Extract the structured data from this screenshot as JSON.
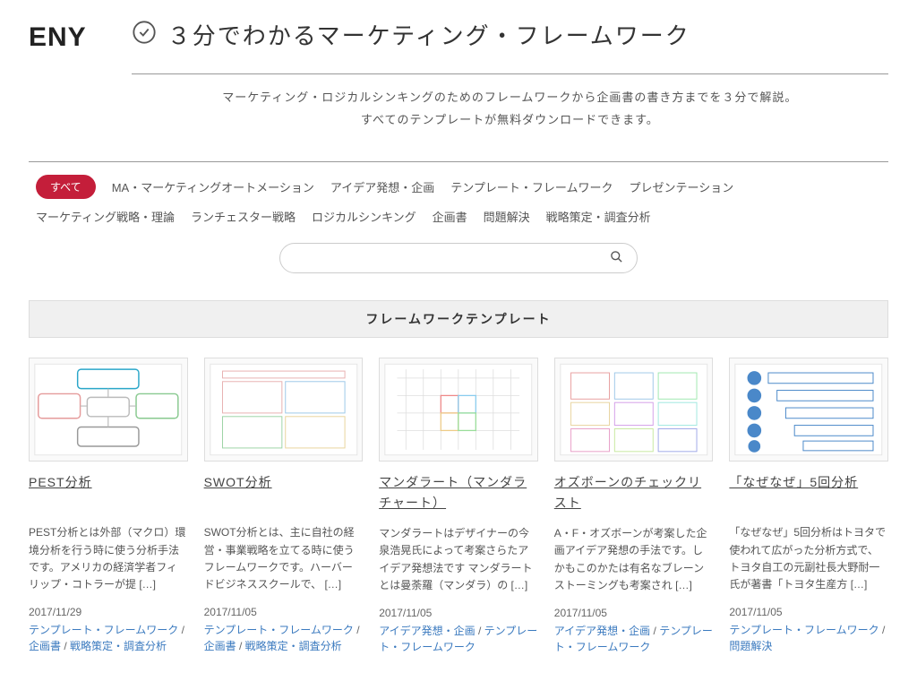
{
  "logo": "ENY",
  "site_title": "３分でわかるマーケティング・フレームワーク",
  "subtitle_line1": "マーケティング・ロジカルシンキングのためのフレームワークから企画書の書き方までを３分で解説。",
  "subtitle_line2": "すべてのテンプレートが無料ダウンロードできます。",
  "categories": [
    {
      "label": "すべて",
      "active": true
    },
    {
      "label": "MA・マーケティングオートメーション",
      "active": false
    },
    {
      "label": "アイデア発想・企画",
      "active": false
    },
    {
      "label": "テンプレート・フレームワーク",
      "active": false
    },
    {
      "label": "プレゼンテーション",
      "active": false
    },
    {
      "label": "マーケティング戦略・理論",
      "active": false
    },
    {
      "label": "ランチェスター戦略",
      "active": false
    },
    {
      "label": "ロジカルシンキング",
      "active": false
    },
    {
      "label": "企画書",
      "active": false
    },
    {
      "label": "問題解決",
      "active": false
    },
    {
      "label": "戦略策定・調査分析",
      "active": false
    }
  ],
  "search_placeholder": "",
  "section_heading": "フレームワークテンプレート",
  "cards": [
    {
      "title": "PEST分析",
      "desc": "PEST分析とは外部（マクロ）環境分析を行う時に使う分析手法です。アメリカの経済学者フィリップ・コトラーが提 […]",
      "date": "2017/11/29",
      "tags": [
        "テンプレート・フレームワーク",
        "企画書",
        "戦略策定・調査分析"
      ]
    },
    {
      "title": "SWOT分析",
      "desc": "SWOT分析とは、主に自社の経営・事業戦略を立てる時に使うフレームワークです。ハーバードビジネススクールで、 […]",
      "date": "2017/11/05",
      "tags": [
        "テンプレート・フレームワーク",
        "企画書",
        "戦略策定・調査分析"
      ]
    },
    {
      "title": "マンダラート（マンダラチャート）",
      "desc": "マンダラートはデザイナーの今泉浩晃氏によって考案さらたアイデア発想法です マンダラートとは曼荼羅（マンダラ）の […]",
      "date": "2017/11/05",
      "tags": [
        "アイデア発想・企画",
        "テンプレート・フレームワーク"
      ]
    },
    {
      "title": "オズボーンのチェックリスト",
      "desc": "A・F・オズボーンが考案した企画アイデア発想の手法です。しかもこのかたは有名なブレーンストーミングも考案され […]",
      "date": "2017/11/05",
      "tags": [
        "アイデア発想・企画",
        "テンプレート・フレームワーク"
      ]
    },
    {
      "title": "「なぜなぜ」5回分析",
      "desc": "「なぜなぜ」5回分析はトヨタで使われて広がった分析方式で、トヨタ自工の元副社長大野耐一氏が著書「トヨタ生産方 […]",
      "date": "2017/11/05",
      "tags": [
        "テンプレート・フレームワーク",
        "問題解決"
      ]
    }
  ]
}
